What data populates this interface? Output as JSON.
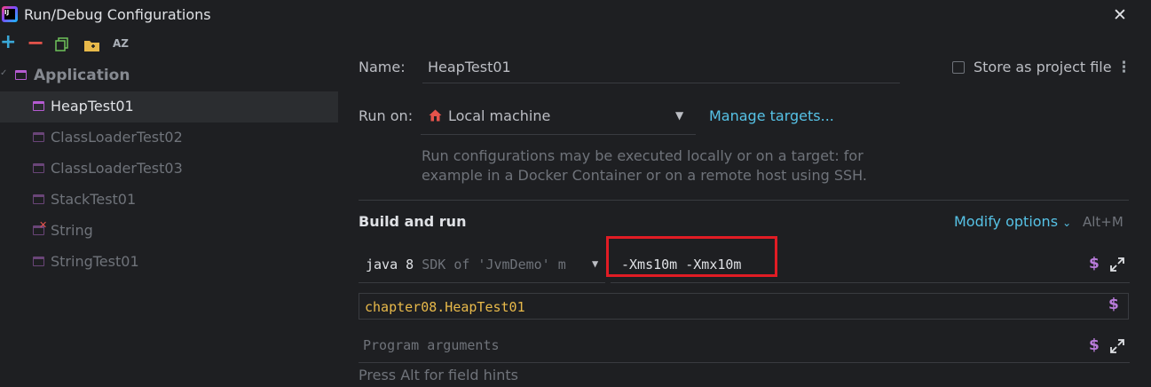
{
  "window": {
    "title": "Run/Debug Configurations",
    "logo_text": "IJ"
  },
  "toolbar": {
    "add": "+",
    "remove": "−",
    "sort_label": "AZ"
  },
  "tree": {
    "group": "Application",
    "items": [
      {
        "label": "HeapTest01",
        "selected": true
      },
      {
        "label": "ClassLoaderTest02"
      },
      {
        "label": "ClassLoaderTest03"
      },
      {
        "label": "StackTest01"
      },
      {
        "label": "String",
        "error": true
      },
      {
        "label": "StringTest01"
      }
    ]
  },
  "form": {
    "name_label": "Name:",
    "name_value": "HeapTest01",
    "store_label": "Store as project file",
    "run_on_label": "Run on:",
    "run_on_value": "Local machine",
    "manage_targets": "Manage targets...",
    "run_on_hint": "Run configurations may be executed locally or on a target: for example in a Docker Container or on a remote host using SSH.",
    "section_title": "Build and run",
    "modify_options": "Modify options",
    "modify_shortcut": "Alt+M",
    "sdk_value": "java 8",
    "sdk_detail": "SDK of 'JvmDemo' m",
    "vm_options": "-Xms10m -Xmx10m",
    "main_class": "chapter08.HeapTest01",
    "args_placeholder": "Program arguments",
    "footer_hint": "Press Alt for field hints"
  },
  "colors": {
    "background": "#1e1f22",
    "link": "#56c2e6",
    "highlight_box": "#e11c24",
    "main_class_text": "#e8b94a",
    "macro_dollar": "#b87bd9"
  }
}
